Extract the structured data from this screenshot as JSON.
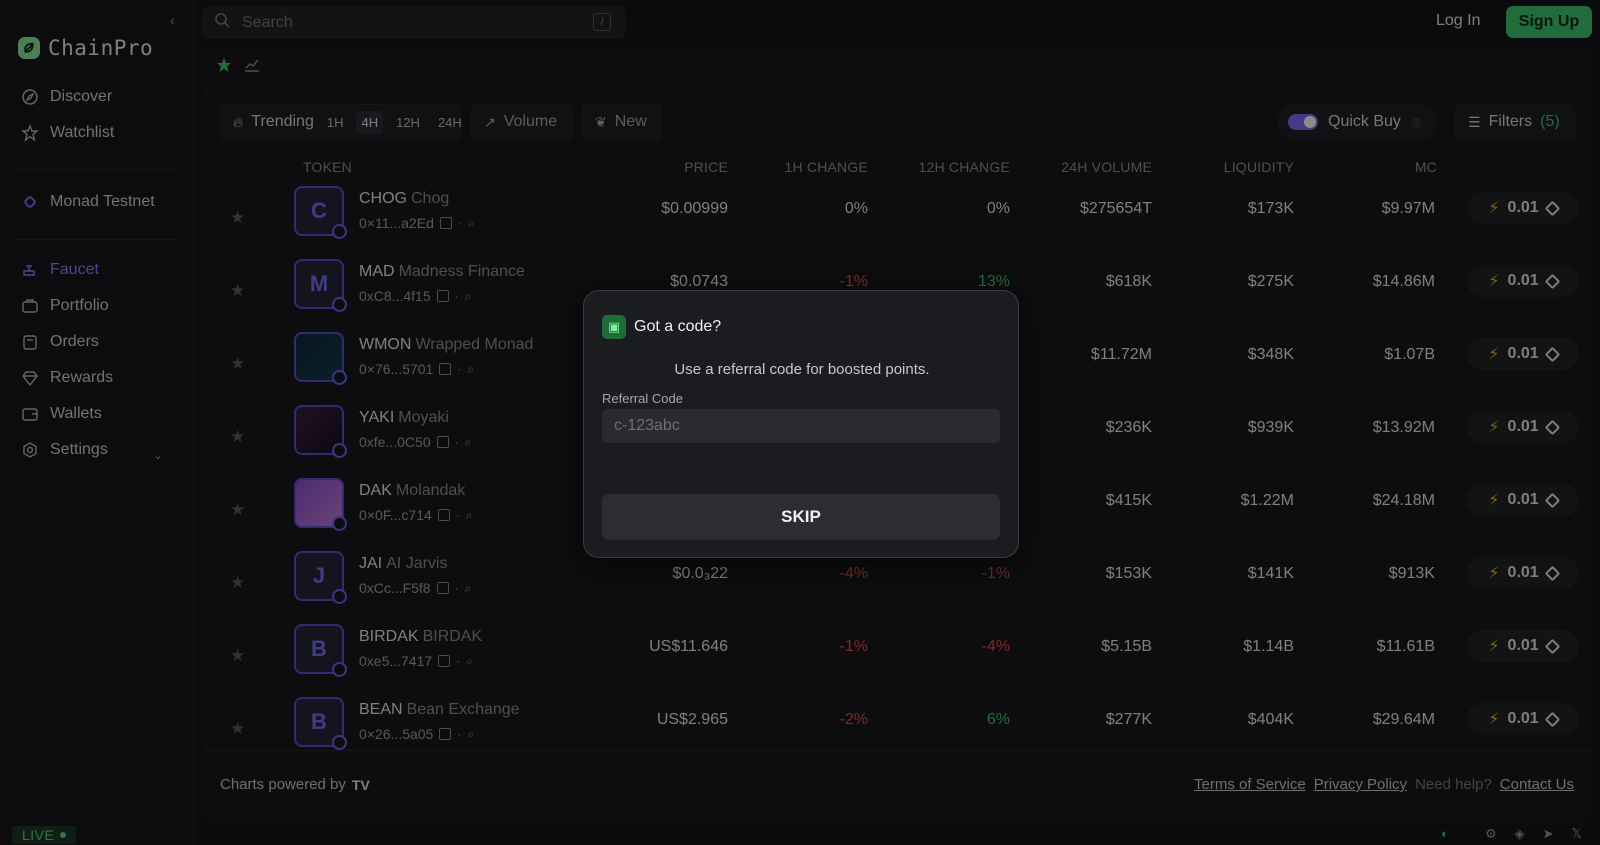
{
  "app": {
    "name": "ChainPro"
  },
  "search": {
    "placeholder": "Search",
    "shortcut": "/"
  },
  "auth": {
    "login": "Log In",
    "signup": "Sign Up"
  },
  "sidebar": {
    "items": [
      {
        "label": "Discover",
        "icon": "compass-icon"
      },
      {
        "label": "Watchlist",
        "icon": "star-icon"
      },
      {
        "label": "Monad Testnet",
        "icon": "monad-icon"
      },
      {
        "label": "Faucet",
        "icon": "faucet-icon"
      },
      {
        "label": "Portfolio",
        "icon": "briefcase-icon"
      },
      {
        "label": "Orders",
        "icon": "clipboard-icon"
      },
      {
        "label": "Rewards",
        "icon": "gem-icon"
      },
      {
        "label": "Wallets",
        "icon": "wallet-icon"
      },
      {
        "label": "Settings",
        "icon": "gear-icon"
      }
    ],
    "status": "LIVE"
  },
  "filters": {
    "trending": "Trending",
    "timeframes": [
      "1H",
      "4H",
      "12H",
      "24H"
    ],
    "selected_timeframe": "4H",
    "volume": "Volume",
    "new": "New",
    "quick_buy": "Quick Buy",
    "filters_label": "Filters",
    "filters_count": "(5)"
  },
  "table": {
    "headers": [
      "TOKEN",
      "PRICE",
      "1H CHANGE",
      "12H CHANGE",
      "24H VOLUME",
      "LIQUIDITY",
      "MC"
    ],
    "rows": [
      {
        "initial": "C",
        "symbol": "CHOG",
        "name": "Chog",
        "address": "0×11...a2Ed",
        "price": "$0.00999",
        "h1": "0%",
        "h12": "0%",
        "vol": "$275654T",
        "liq": "$173K",
        "mc": "$9.97M",
        "buy": "0.01"
      },
      {
        "initial": "M",
        "symbol": "MAD",
        "name": "Madness Finance",
        "address": "0xC8...4f15",
        "price": "$0.0743",
        "h1": "-1%",
        "h12": "13%",
        "vol": "$618K",
        "liq": "$275K",
        "mc": "$14.86M",
        "buy": "0.01"
      },
      {
        "initial": "",
        "symbol": "WMON",
        "name": "Wrapped Monad",
        "address": "0×76...5701",
        "price": "",
        "h1": "",
        "h12": "",
        "vol": "$11.72M",
        "liq": "$348K",
        "mc": "$1.07B",
        "buy": "0.01"
      },
      {
        "initial": "",
        "symbol": "YAKI",
        "name": "Moyaki",
        "address": "0xfe...0C50",
        "price": "",
        "h1": "",
        "h12": "",
        "vol": "$236K",
        "liq": "$939K",
        "mc": "$13.92M",
        "buy": "0.01"
      },
      {
        "initial": "",
        "symbol": "DAK",
        "name": "Molandak",
        "address": "0×0F...c714",
        "price": "",
        "h1": "",
        "h12": "",
        "vol": "$415K",
        "liq": "$1.22M",
        "mc": "$24.18M",
        "buy": "0.01"
      },
      {
        "initial": "J",
        "symbol": "JAI",
        "name": "AI Jarvis",
        "address": "0xCc...F5f8",
        "price": "$0.0₃22",
        "h1": "-4%",
        "h12": "-1%",
        "vol": "$153K",
        "liq": "$141K",
        "mc": "$913K",
        "buy": "0.01"
      },
      {
        "initial": "B",
        "symbol": "BIRDAK",
        "name": "BIRDAK",
        "address": "0xe5...7417",
        "price": "US$11.646",
        "h1": "-1%",
        "h12": "-4%",
        "vol": "$5.15B",
        "liq": "$1.14B",
        "mc": "$11.61B",
        "buy": "0.01"
      },
      {
        "initial": "B",
        "symbol": "BEAN",
        "name": "Bean Exchange",
        "address": "0×26...5a05",
        "price": "US$2.965",
        "h1": "-2%",
        "h12": "6%",
        "vol": "$277K",
        "liq": "$404K",
        "mc": "$29.64M",
        "buy": "0.01"
      }
    ]
  },
  "footer": {
    "charts": "Charts powered by",
    "tv": "TV",
    "terms": "Terms of Service",
    "privacy": "Privacy Policy",
    "help": "Need help?",
    "contact": "Contact Us"
  },
  "modal": {
    "title": "Got a code?",
    "subtitle": "Use a referral code for boosted points.",
    "label": "Referral Code",
    "placeholder": "c-123abc",
    "skip": "SKIP"
  },
  "colors": {
    "accent": "#3ec46d",
    "purple": "#7a6cf0",
    "negative": "#e14b4b"
  }
}
